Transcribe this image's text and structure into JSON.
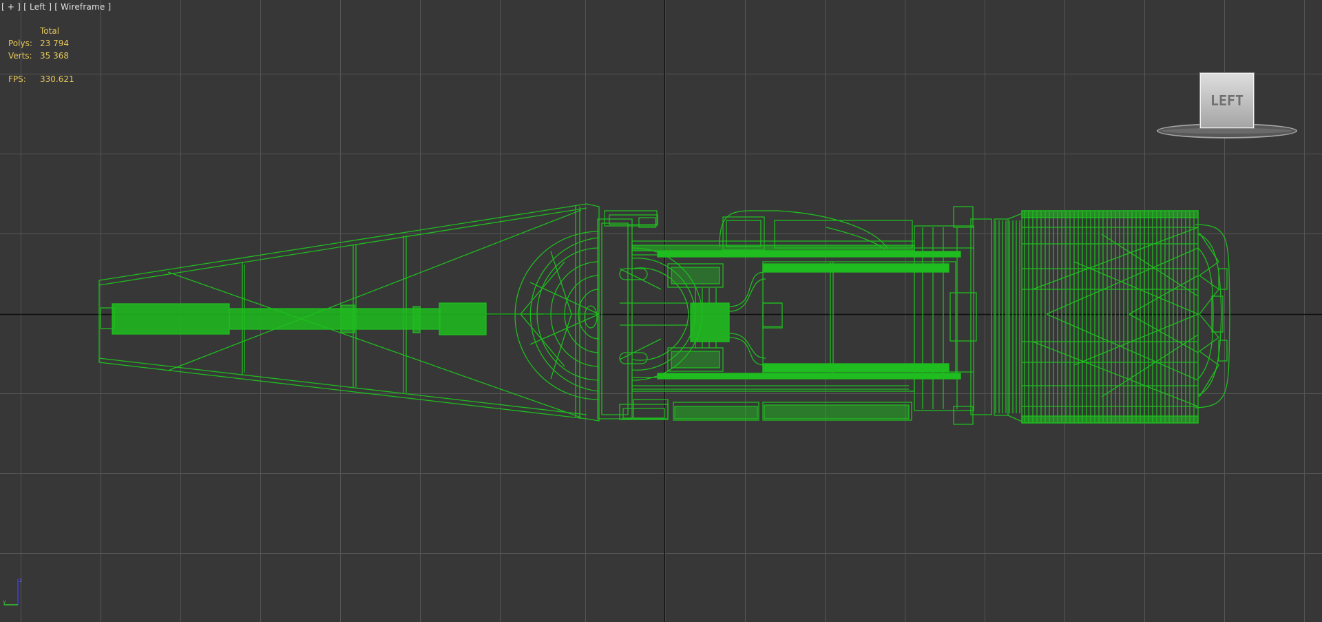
{
  "viewport": {
    "label_menu": {
      "plus": "[ + ]",
      "view": "[ Left ]",
      "shading": "[ Wireframe ]"
    },
    "stats": {
      "header": "Total",
      "polys_label": "Polys:",
      "polys_value": "23 794",
      "verts_label": "Verts:",
      "verts_value": "35 368",
      "fps_label": "FPS:",
      "fps_value": "330.621"
    },
    "viewcube_label": "LEFT",
    "axis": {
      "z": "z",
      "y": "y"
    }
  },
  "colors": {
    "background": "#373737",
    "grid": "#555555",
    "home_grid": "#0f0f0f",
    "wireframe": "#1fbd1f",
    "stats_text": "#e6c75a",
    "axis_z": "#3d3dea",
    "axis_y": "#2fce2f"
  }
}
